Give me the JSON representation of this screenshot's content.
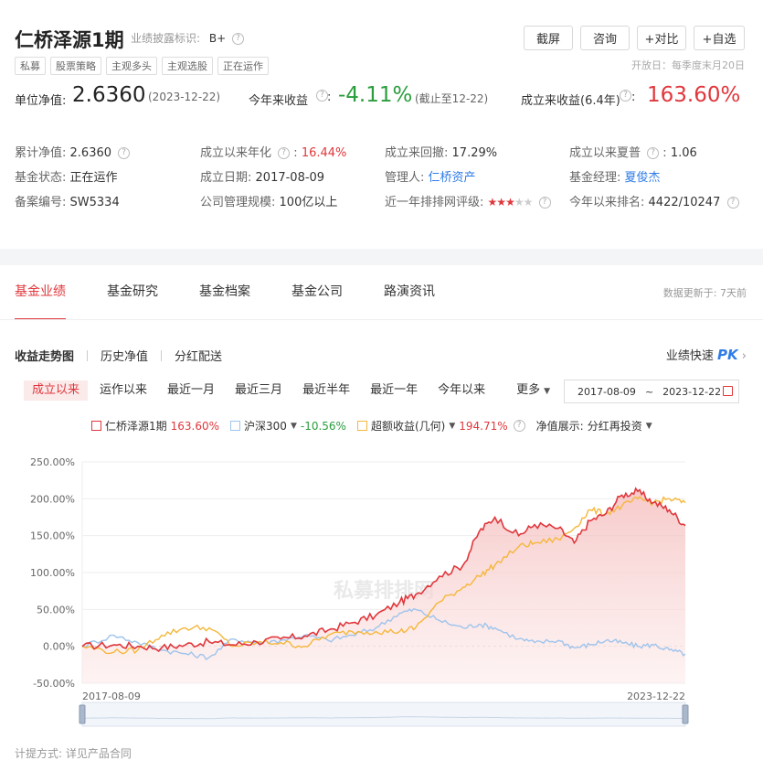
{
  "header": {
    "title": "仁桥泽源1期",
    "disclosure_label": "业绩披露标识:",
    "disclosure_grade": "B+",
    "tags": [
      "私募",
      "股票策略",
      "主观多头",
      "主观选股",
      "正在运作"
    ],
    "buttons": [
      "截屏",
      "咨询",
      "+对比",
      "+自选"
    ],
    "open_day": "开放日：每季度末月20日"
  },
  "nav": {
    "unit_nav_label": "单位净值:",
    "unit_nav_value": "2.6360",
    "unit_nav_date": "(2023-12-22)",
    "ytd_label": "今年来收益",
    "ytd_value": "-4.11%",
    "ytd_note": "(截止至12-22)",
    "since_label": "成立来收益(6.4年)",
    "since_value": "163.60%",
    "colon": ":"
  },
  "info": {
    "row1": [
      {
        "label": "累计净值:",
        "value": "2.6360"
      },
      {
        "label": "成立以来年化",
        "value": "16.44%"
      },
      {
        "label": "成立来回撤:",
        "value": "17.29%"
      },
      {
        "label": "成立以来夏普",
        "value": "1.06"
      }
    ],
    "row2": [
      {
        "label": "基金状态:",
        "value": "正在运作"
      },
      {
        "label": "成立日期:",
        "value": "2017-08-09"
      },
      {
        "label": "管理人:",
        "value": "仁桥资产"
      },
      {
        "label": "基金经理:",
        "value": "夏俊杰"
      }
    ],
    "row3": [
      {
        "label": "备案编号:",
        "value": "SW5334"
      },
      {
        "label": "公司管理规模:",
        "value": "100亿以上"
      },
      {
        "label": "近一年排排网评级:",
        "value": ""
      },
      {
        "label": "今年以来排名:",
        "value": "4422/10247"
      }
    ],
    "rating_stars": 3,
    "rating_max": 5,
    "colon": ":"
  },
  "tabs": [
    "基金业绩",
    "基金研究",
    "基金档案",
    "基金公司",
    "路演资讯"
  ],
  "update_note": "数据更新于: 7天前",
  "subtabs": [
    "收益走势图",
    "历史净值",
    "分红配送"
  ],
  "pk_link": {
    "label": "业绩快速",
    "pk": "PK"
  },
  "ranges": [
    "成立以来",
    "运作以来",
    "最近一月",
    "最近三月",
    "最近半年",
    "最近一年",
    "今年以来"
  ],
  "range_more": "更多",
  "date_range": {
    "start": "2017-08-09",
    "sep": "~",
    "end": "2023-12-22"
  },
  "legend": {
    "items": [
      {
        "name": "仁桥泽源1期",
        "value": "163.60%",
        "color": "#e0373c",
        "value_color": "#e0373c"
      },
      {
        "name": "沪深300",
        "value": "-10.56%",
        "color": "#9ec4ec",
        "value_color": "#2a9d3c"
      },
      {
        "name": "超额收益(几何)",
        "value": "194.71%",
        "color": "#f5b73b",
        "value_color": "#e0373c"
      }
    ],
    "display_label": "净值展示:",
    "display_value": "分红再投资"
  },
  "watermark": "私募排排网",
  "footnote": "计提方式: 详见产品合同",
  "chart_data": {
    "type": "line",
    "x_start": "2017-08-09",
    "x_end": "2023-12-22",
    "xticks": [
      "2017-08-09",
      "2023-12-22"
    ],
    "ylim": [
      -50,
      250
    ],
    "yticks": [
      "250.00%",
      "200.00%",
      "150.00%",
      "100.00%",
      "50.00%",
      "0.00%",
      "-50.00%"
    ],
    "ytick_values": [
      250,
      200,
      150,
      100,
      50,
      0,
      -50
    ],
    "grid": true,
    "area_fill_series": 0,
    "series": [
      {
        "name": "仁桥泽源1期",
        "color": "#e0373c",
        "x": [
          "2017-08",
          "2017-12",
          "2018-03",
          "2018-06",
          "2018-09",
          "2018-12",
          "2019-03",
          "2019-06",
          "2019-09",
          "2019-12",
          "2020-03",
          "2020-06",
          "2020-09",
          "2020-12",
          "2021-02",
          "2021-05",
          "2021-08",
          "2021-10",
          "2021-12",
          "2022-03",
          "2022-05",
          "2022-08",
          "2022-10",
          "2022-12",
          "2023-02",
          "2023-04",
          "2023-06",
          "2023-08",
          "2023-10",
          "2023-12"
        ],
        "values": [
          0,
          2,
          0,
          -2,
          2,
          6,
          2,
          6,
          10,
          14,
          22,
          32,
          42,
          60,
          70,
          95,
          110,
          155,
          175,
          150,
          165,
          160,
          140,
          170,
          180,
          205,
          210,
          195,
          185,
          163.6
        ]
      },
      {
        "name": "沪深300",
        "color": "#9ec4ec",
        "x": [
          "2017-08",
          "2017-12",
          "2018-03",
          "2018-06",
          "2018-09",
          "2018-12",
          "2019-03",
          "2019-06",
          "2019-09",
          "2019-12",
          "2020-03",
          "2020-06",
          "2020-09",
          "2020-12",
          "2021-02",
          "2021-05",
          "2021-08",
          "2021-10",
          "2021-12",
          "2022-03",
          "2022-05",
          "2022-08",
          "2022-10",
          "2022-12",
          "2023-02",
          "2023-04",
          "2023-06",
          "2023-08",
          "2023-10",
          "2023-12"
        ],
        "values": [
          0,
          15,
          5,
          -5,
          -10,
          -15,
          10,
          5,
          8,
          15,
          8,
          15,
          25,
          45,
          50,
          35,
          25,
          30,
          25,
          10,
          5,
          8,
          -2,
          2,
          8,
          5,
          0,
          2,
          -5,
          -10.56
        ]
      },
      {
        "name": "超额收益(几何)",
        "color": "#f5b73b",
        "x": [
          "2017-08",
          "2017-12",
          "2018-03",
          "2018-06",
          "2018-09",
          "2018-12",
          "2019-03",
          "2019-06",
          "2019-09",
          "2019-12",
          "2020-03",
          "2020-06",
          "2020-09",
          "2020-12",
          "2021-02",
          "2021-05",
          "2021-08",
          "2021-10",
          "2021-12",
          "2022-03",
          "2022-05",
          "2022-08",
          "2022-10",
          "2022-12",
          "2023-02",
          "2023-04",
          "2023-06",
          "2023-08",
          "2023-10",
          "2023-12"
        ],
        "values": [
          0,
          -8,
          -5,
          15,
          25,
          25,
          0,
          5,
          5,
          0,
          15,
          20,
          20,
          20,
          25,
          60,
          80,
          95,
          110,
          135,
          140,
          145,
          160,
          185,
          180,
          190,
          200,
          195,
          200,
          194.71
        ]
      }
    ]
  }
}
